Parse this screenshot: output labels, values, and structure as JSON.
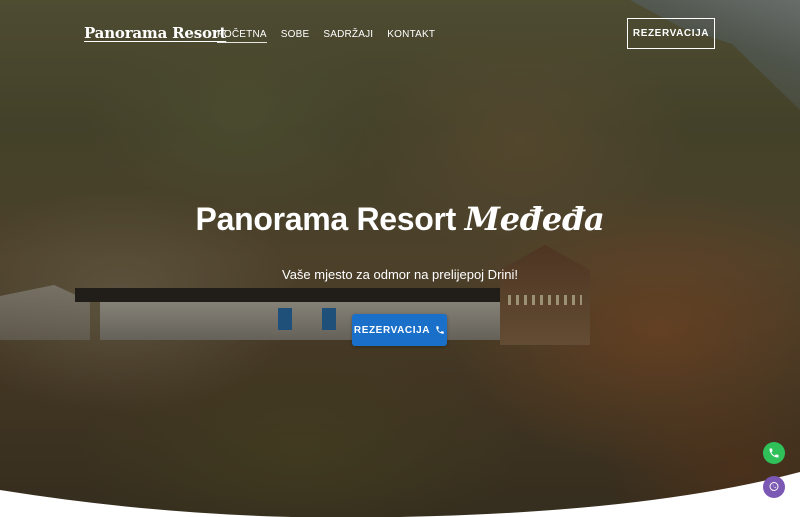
{
  "header": {
    "logo": "Panorama Resort",
    "nav": [
      {
        "label": "POČETNA",
        "active": true
      },
      {
        "label": "SOBE",
        "active": false
      },
      {
        "label": "SADRŽAJI",
        "active": false
      },
      {
        "label": "KONTAKT",
        "active": false
      }
    ],
    "reserve_button": "REZERVACIJA"
  },
  "hero": {
    "title_main": "Panorama Resort",
    "title_accent": "Međeđa",
    "subtitle": "Vaše mjesto za odmor na prelijepoj Drini!",
    "cta_label": "REZERVACIJA",
    "cta_icon": "phone-icon"
  },
  "floating": {
    "phone_icon": "phone-icon",
    "viber_icon": "viber-icon",
    "phone_color": "#2fc05a",
    "viber_color": "#7b58b3"
  },
  "colors": {
    "accent": "#1a6fc9"
  }
}
